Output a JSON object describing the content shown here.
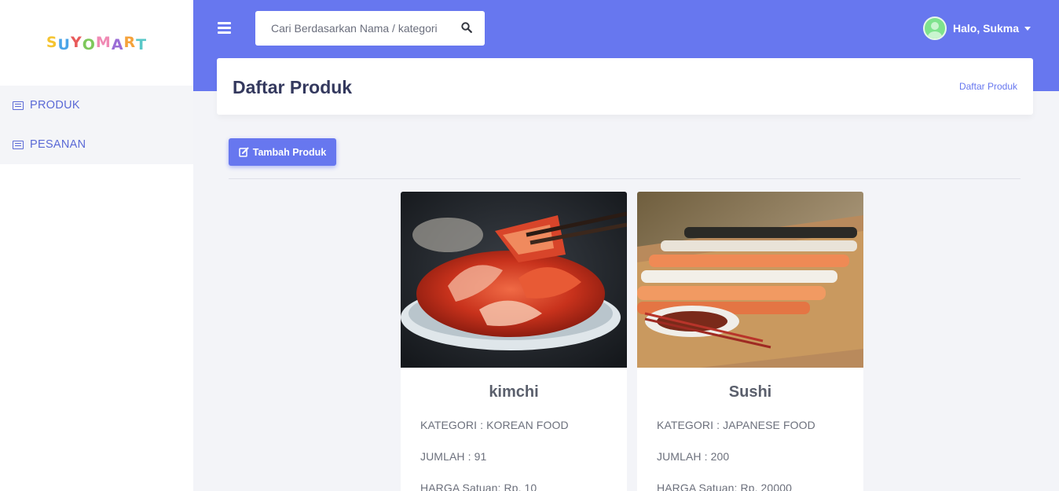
{
  "app": {
    "logo_text": "SUYOMART",
    "logo_colors": [
      "#f5c431",
      "#4aa4e8",
      "#e85a5a",
      "#7ec85b",
      "#f08ab4",
      "#9a6cd6",
      "#f5a23a",
      "#5ac8c8"
    ]
  },
  "sidebar": {
    "items": [
      {
        "label": "PRODUK",
        "icon": "list-icon"
      },
      {
        "label": "PESANAN",
        "icon": "list-icon"
      }
    ]
  },
  "topbar": {
    "search_placeholder": "Cari Berdasarkan Nama / kategori",
    "search_icon": "search-icon",
    "user_greeting": "Halo, Sukma"
  },
  "header": {
    "title": "Daftar Produk",
    "breadcrumb": "Daftar Produk"
  },
  "actions": {
    "add_label": "Tambah Produk"
  },
  "products": [
    {
      "name": "kimchi",
      "category_label": "KATEGORI :",
      "category": "KOREAN FOOD",
      "qty_label": "JUMLAH :",
      "qty": "91",
      "price_label": "HARGA Satuan:",
      "price": "Rp. 10",
      "image_icon": "kimchi-photo"
    },
    {
      "name": "Sushi",
      "category_label": "KATEGORI :",
      "category": "JAPANESE FOOD",
      "qty_label": "JUMLAH :",
      "qty": "200",
      "price_label": "HARGA Satuan:",
      "price": "Rp. 20000",
      "image_icon": "sushi-photo"
    }
  ],
  "colors": {
    "primary": "#6777ef",
    "sidebar_text": "#5a69d6"
  }
}
